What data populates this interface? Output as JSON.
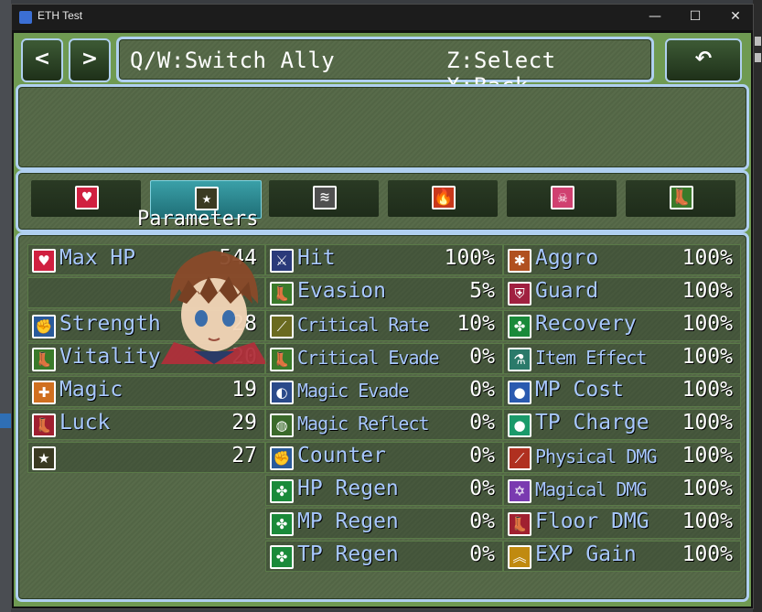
{
  "window": {
    "title": "ETH Test"
  },
  "titlebar_controls": {
    "minimize": "—",
    "maximize": "☐",
    "close": "✕"
  },
  "nav": {
    "prev": "<",
    "next": ">",
    "back": "↶"
  },
  "help": {
    "left": "Q/W:Switch Ally",
    "right": "Z:Select X:Back"
  },
  "categories": {
    "icons": [
      "heart-icon",
      "stars-icon",
      "claws-icon",
      "fire-icon",
      "skull-icon",
      "boot-icon"
    ],
    "glyphs": [
      "♥",
      "★",
      "≋",
      "🔥",
      "☠",
      "👢"
    ],
    "selected_index": 1,
    "selected_label": "Parameters"
  },
  "params": [
    {
      "icon": "heart-icon",
      "glyph": "♥",
      "name": "Max HP",
      "value": "544"
    },
    {
      "icon": "",
      "glyph": "",
      "name": "",
      "value": ""
    },
    {
      "icon": "fist-icon",
      "glyph": "✊",
      "name": "Strength",
      "value": "28"
    },
    {
      "icon": "boot-icon",
      "glyph": "👢",
      "name": "Vitality",
      "value": "20"
    },
    {
      "icon": "shield-cross-icon",
      "glyph": "✚",
      "name": "Magic",
      "value": "19"
    },
    {
      "icon": "boot-red-icon",
      "glyph": "👢",
      "name": "Luck",
      "value": "29"
    },
    {
      "icon": "stars-icon",
      "glyph": "★",
      "name": "",
      "value": "27"
    }
  ],
  "xparams": [
    {
      "icon": "swords-icon",
      "glyph": "⚔",
      "name": "Hit",
      "value": "100%",
      "narrow": false
    },
    {
      "icon": "boot-icon",
      "glyph": "👢",
      "name": "Evasion",
      "value": "5%",
      "narrow": false
    },
    {
      "icon": "slash-icon",
      "glyph": "⟋",
      "name": "Critical Rate",
      "value": "10%",
      "narrow": true
    },
    {
      "icon": "boot-icon",
      "glyph": "👢",
      "name": "Critical Evade",
      "value": "0%",
      "narrow": true
    },
    {
      "icon": "magic-orb-icon",
      "glyph": "◐",
      "name": "Magic Evade",
      "value": "0%",
      "narrow": true
    },
    {
      "icon": "reflect-icon",
      "glyph": "◍",
      "name": "Magic Reflect",
      "value": "0%",
      "narrow": true
    },
    {
      "icon": "fist-icon",
      "glyph": "✊",
      "name": "Counter",
      "value": "0%",
      "narrow": false
    },
    {
      "icon": "clover-icon",
      "glyph": "✤",
      "name": "HP Regen",
      "value": "0%",
      "narrow": false
    },
    {
      "icon": "clover-icon",
      "glyph": "✤",
      "name": "MP Regen",
      "value": "0%",
      "narrow": false
    },
    {
      "icon": "clover-icon",
      "glyph": "✤",
      "name": "TP Regen",
      "value": "0%",
      "narrow": false
    }
  ],
  "sparams": [
    {
      "icon": "aggro-icon",
      "glyph": "✱",
      "name": "Aggro",
      "value": "100%",
      "narrow": false
    },
    {
      "icon": "guard-shield-icon",
      "glyph": "⛨",
      "name": "Guard",
      "value": "100%",
      "narrow": false
    },
    {
      "icon": "clover-icon",
      "glyph": "✤",
      "name": "Recovery",
      "value": "100%",
      "narrow": false
    },
    {
      "icon": "potion-icon",
      "glyph": "⚗",
      "name": "Item Effect",
      "value": "100%",
      "narrow": true
    },
    {
      "icon": "mp-orb-icon",
      "glyph": "●",
      "name": "MP Cost",
      "value": "100%",
      "narrow": false
    },
    {
      "icon": "tp-orb-icon",
      "glyph": "●",
      "name": "TP Charge",
      "value": "100%",
      "narrow": false
    },
    {
      "icon": "sword-icon",
      "glyph": "⟋",
      "name": "Physical DMG",
      "value": "100%",
      "narrow": true
    },
    {
      "icon": "hexagram-icon",
      "glyph": "✡",
      "name": "Magical DMG",
      "value": "100%",
      "narrow": true
    },
    {
      "icon": "boot-red-icon",
      "glyph": "👢",
      "name": "Floor DMG",
      "value": "100%",
      "narrow": false
    },
    {
      "icon": "chevron-up-icon",
      "glyph": "︽",
      "name": "EXP Gain",
      "value": "100%",
      "narrow": false
    }
  ],
  "colors": {
    "stat_name": "#a8c8ff",
    "value": "#ffffff",
    "frame": "#b0d0f0",
    "window_bg": "#6f9a52"
  }
}
